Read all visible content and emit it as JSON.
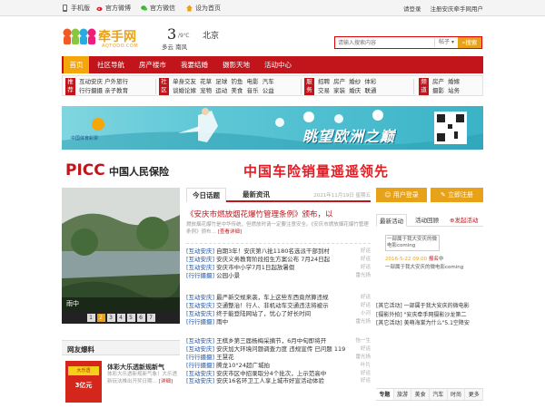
{
  "topbar": {
    "links": [
      {
        "label": "手机版",
        "icon": "mobile-icon"
      },
      {
        "label": "官方微博",
        "icon": "weibo-icon"
      },
      {
        "label": "官方微信",
        "icon": "wechat-icon"
      },
      {
        "label": "设为首页",
        "icon": "home-icon"
      }
    ],
    "login": "请登录",
    "register": "注册安庆牵手网用户"
  },
  "header": {
    "logo_text": "牵手网",
    "logo_sub": "AQTODO.COM",
    "temp": "3",
    "temp_unit": "/9℃",
    "weather": "多云 南风",
    "city": "北京",
    "search_placeholder": "请输入搜索内容",
    "search_type": "帖子",
    "search_button": "搜索"
  },
  "nav": [
    "首页",
    "社区导航",
    "房产楼市",
    "我要结婚",
    "摄影天地",
    "活动中心"
  ],
  "categories": {
    "recommend_tag": "推荐",
    "recommend": [
      [
        "互动安庆",
        "户外旅行"
      ],
      [
        "行行摄摄",
        "亲子教育"
      ]
    ],
    "community_tag": "社区",
    "community": [
      [
        "单身交友",
        "花草",
        "足球",
        "钓鱼",
        "电影",
        "汽车"
      ],
      [
        "谈婚论嫁",
        "宠物",
        "运动",
        "美食",
        "音乐",
        "公益"
      ]
    ],
    "service_tag": "服务",
    "service": [
      [
        "招聘",
        "房产",
        "婚纱",
        "体彩"
      ],
      [
        "交易",
        "家装",
        "婚庆",
        "联通"
      ]
    ],
    "channel_tag": "频道",
    "channel": [
      [
        "房产",
        "婚嫁"
      ],
      [
        "摄影",
        "站务"
      ]
    ]
  },
  "banners": {
    "lottery_text": "中国体育彩票",
    "euro_text": "眺望欧洲之巅",
    "picc_text": "中国人民保险",
    "car_ins_text": "中国车险销量遥遥领先"
  },
  "featured": {
    "caption": "雨中",
    "pages": [
      "1",
      "2",
      "3",
      "4",
      "5",
      "6",
      "7"
    ],
    "active_page": 2
  },
  "netizen": {
    "title": "网友爆料",
    "item_title": "体彩大乐透新规新气",
    "item_text": "体彩大乐透新规新气象！大乐透新玩法推出开奖日期…",
    "item_more": "[详细]"
  },
  "news": {
    "tabs": [
      "今日话题",
      "最新资讯"
    ],
    "date": "2021年11月19日 星期五",
    "headline": "《安庆市燃放烟花爆竹管理条例》颁布，以",
    "summary": "燃放烟花爆竹是中华传统，但燃放时请一定要注意安全。《安庆市燃放烟花爆竹管理条例》颁布… ",
    "summary_more": "[查看详细]",
    "group1": [
      {
        "tag": "[互动安庆]",
        "title": "自期3年！安庆第八批1180名选派干部到村",
        "src": "好运"
      },
      {
        "tag": "[互动安庆]",
        "title": "安庆义务教育阶段招生方案公布 7月24日起",
        "src": "好运"
      },
      {
        "tag": "[互动安庆]",
        "title": "安庆市中小学7月1日起放暑假",
        "src": "好运"
      },
      {
        "tag": "[行行摄摄]",
        "title": "公园小景",
        "src": "雷光扬"
      }
    ],
    "group2": [
      {
        "tag": "[互动安庆]",
        "title": "最严新交规来袭，车上这些东西竟然算违规",
        "src": "好运"
      },
      {
        "tag": "[互动安庆]",
        "title": "交通整治！行人、非机动车交通违法将被示",
        "src": "好运"
      },
      {
        "tag": "[互动安庆]",
        "title": "终于能登陆网站了，忧心了好长时间",
        "src": "小河"
      },
      {
        "tag": "[行行摄摄]",
        "title": "雨中",
        "src": "雷光扬"
      }
    ],
    "group3": [
      {
        "tag": "[互动安庆]",
        "title": "王棋乡第三届杨梅采摘节，6月中旬即将开",
        "src": "怡一生"
      },
      {
        "tag": "[互动安庆]",
        "title": "安庆加大环境问题调查力度 违规宣传 已问题 119",
        "src": "好运"
      },
      {
        "tag": "[行行摄摄]",
        "title": "王慧花",
        "src": "雷光扬"
      },
      {
        "tag": "[行行摄摄]",
        "title": "腾龙10°24超广城拍",
        "src": "叶片"
      },
      {
        "tag": "[互动安庆]",
        "title": "安庆市区中招录取分4个批次，上示范高中",
        "src": "好运"
      },
      {
        "tag": "[互动安庆]",
        "title": "安庆16名环卫工人享上城市好宣活动体验",
        "src": "好运"
      }
    ]
  },
  "right": {
    "login_button": "用户登录",
    "register_button": "立即注册",
    "tabs": [
      "最新活动",
      "活动回顾",
      "发起活动"
    ],
    "event_title": "一部属于我大安庆的微电影coming",
    "event_date": "2016-5-22 09:00",
    "event_status": "报名中",
    "event_desc": "一部属于我大安庆的微电影coming",
    "list": [
      "[其它活动] 一部属于我大安庆的微电影",
      "[摄影外拍] \"安庆牵手网摄影沙龙第二",
      "[其它活动] 美萌海棠为什么\"5.1空降安"
    ],
    "bottom_tabs": [
      "专题",
      "旅游",
      "美食",
      "汽车",
      "时尚",
      "更多"
    ]
  }
}
